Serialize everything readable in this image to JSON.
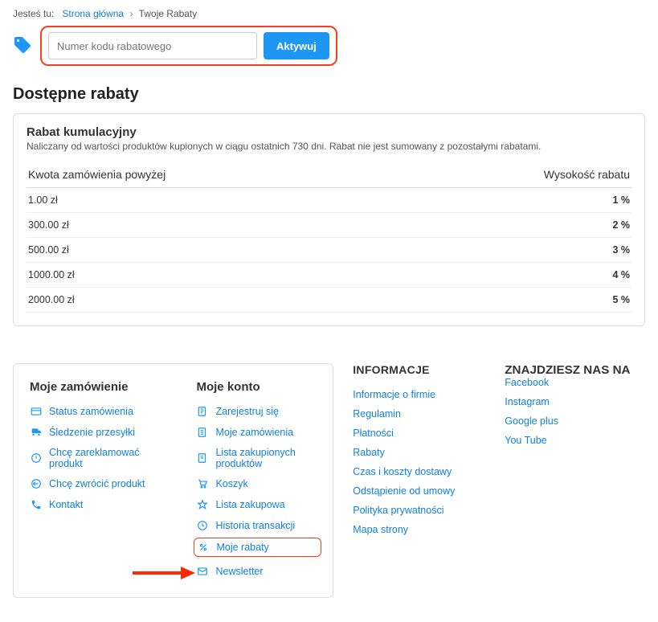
{
  "breadcrumb": {
    "label": "Jesteś tu:",
    "home": "Strona główna",
    "current": "Twoje Rabaty"
  },
  "promo": {
    "placeholder": "Numer kodu rabatowego",
    "button": "Aktywuj"
  },
  "section_title": "Dostępne rabaty",
  "rabat": {
    "title": "Rabat kumulacyjny",
    "desc": "Naliczany od wartości produktów kupionych w ciągu ostatnich 730 dni. Rabat nie jest sumowany z pozostałymi rabatami.",
    "col_left": "Kwota zamówienia powyżej",
    "col_right": "Wysokość rabatu",
    "rows": [
      {
        "amount": "1.00 zł",
        "value": "1 %"
      },
      {
        "amount": "300.00 zł",
        "value": "2 %"
      },
      {
        "amount": "500.00 zł",
        "value": "3 %"
      },
      {
        "amount": "1000.00 zł",
        "value": "4 %"
      },
      {
        "amount": "2000.00 zł",
        "value": "5 %"
      }
    ]
  },
  "footer": {
    "order": {
      "title": "Moje zamówienie",
      "items": [
        {
          "label": "Status zamówienia"
        },
        {
          "label": "Śledzenie przesyłki"
        },
        {
          "label": "Chcę zareklamować produkt"
        },
        {
          "label": "Chcę zwrócić produkt"
        },
        {
          "label": "Kontakt"
        }
      ]
    },
    "account": {
      "title": "Moje konto",
      "items": [
        {
          "label": "Zarejestruj się"
        },
        {
          "label": "Moje zamówienia"
        },
        {
          "label": "Lista zakupionych produktów"
        },
        {
          "label": "Koszyk"
        },
        {
          "label": "Lista zakupowa"
        },
        {
          "label": "Historia transakcji"
        },
        {
          "label": "Moje rabaty"
        },
        {
          "label": "Newsletter"
        }
      ]
    },
    "info": {
      "title": "INFORMACJE",
      "items": [
        "Informacje o firmie",
        "Regulamin",
        "Płatności",
        "Rabaty",
        "Czas i koszty dostawy",
        "Odstąpienie od umowy",
        "Polityka prywatności",
        "Mapa strony"
      ]
    },
    "social": {
      "title": "ZNAJDZIESZ NAS NA",
      "items": [
        "Facebook",
        "Instagram",
        "Google plus",
        "You Tube"
      ]
    }
  }
}
